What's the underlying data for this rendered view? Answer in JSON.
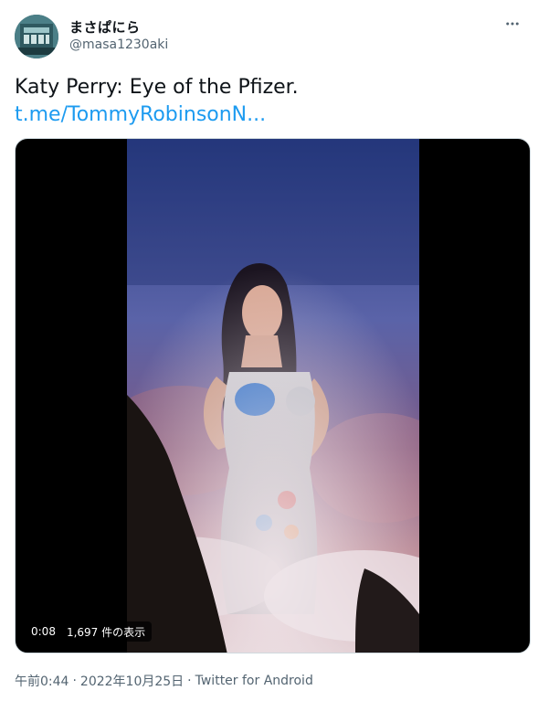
{
  "author": {
    "display_name": "まさぱにら",
    "handle": "@masa1230aki"
  },
  "tweet": {
    "text": "Katy Perry: Eye of the Pfizer.",
    "link": "t.me/TommyRobinsonN..."
  },
  "video": {
    "time": "0:08",
    "views": "1,697 件の表示"
  },
  "meta": {
    "time": "午前0:44",
    "separator": "·",
    "date": "2022年10月25日",
    "source": "Twitter for Android"
  },
  "colors": {
    "link": "#1d9bf0",
    "secondary_text": "#536471",
    "primary_text": "#0f1419"
  },
  "icons": {
    "more": "more-horizontal-icon"
  }
}
